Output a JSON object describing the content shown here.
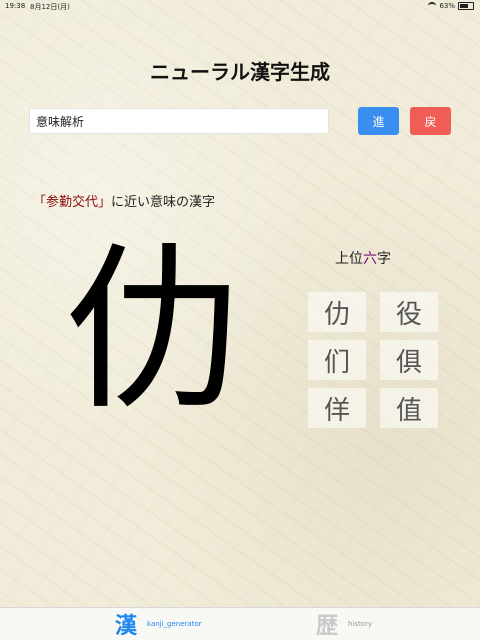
{
  "status_bar": {
    "time": "19:38",
    "date": "8月12日(月)",
    "battery_text": "63%",
    "battery_level": 0.63
  },
  "header": {
    "title": "ニューラル漢字生成"
  },
  "search": {
    "value": "意味解析",
    "go_label": "進",
    "back_label": "戻"
  },
  "result": {
    "open_quote": "「",
    "query": "参勤交代",
    "close_quote": "」",
    "suffix": "に近い意味の漢字",
    "main_character": "仂",
    "top_label_prefix": "上位",
    "top_label_count": "六",
    "top_label_suffix": "字",
    "candidates": [
      "仂",
      "役",
      "们",
      "俱",
      "佯",
      "值"
    ]
  },
  "tab_bar": {
    "tabs": [
      {
        "icon": "漢",
        "label": "kanji_generator",
        "active": true
      },
      {
        "icon": "歴",
        "label": "history",
        "active": false
      }
    ]
  },
  "colors": {
    "accent": "#1d86f0",
    "go_button": "#3a8ef0",
    "back_button": "#ef5d55",
    "query_text": "#8b0c0c",
    "count_text": "#7a0d7a"
  }
}
